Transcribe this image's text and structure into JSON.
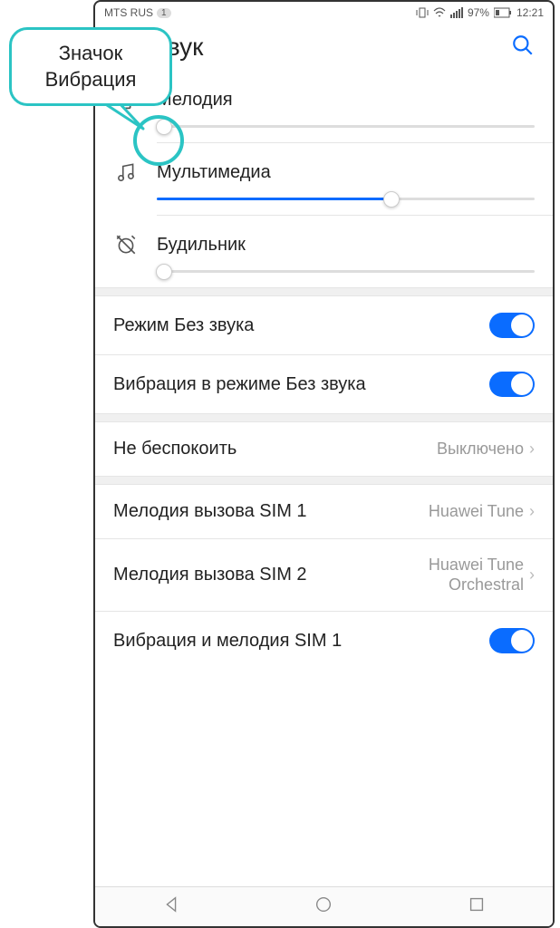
{
  "callout": {
    "line1": "Значок",
    "line2": "Вибрация"
  },
  "status": {
    "carrier": "MTS RUS",
    "sim": "1",
    "battery": "97%",
    "time": "12:21"
  },
  "header": {
    "title": "Звук"
  },
  "sliders": {
    "ringtone": {
      "label": "Мелодия",
      "value": 2
    },
    "media": {
      "label": "Мультимедиа",
      "value": 62
    },
    "alarm": {
      "label": "Будильник",
      "value": 2
    }
  },
  "toggles": {
    "silent": {
      "label": "Режим Без звука",
      "on": true
    },
    "vibrate_silent": {
      "label": "Вибрация в режиме Без звука",
      "on": true
    },
    "vibrate_sim1": {
      "label": "Вибрация и мелодия SIM 1",
      "on": true
    }
  },
  "nav_rows": {
    "dnd": {
      "label": "Не беспокоить",
      "value": "Выключено"
    },
    "sim1": {
      "label": "Мелодия вызова SIM 1",
      "value": "Huawei Tune"
    },
    "sim2": {
      "label": "Мелодия вызова SIM 2",
      "value": "Huawei Tune Orchestral"
    }
  }
}
